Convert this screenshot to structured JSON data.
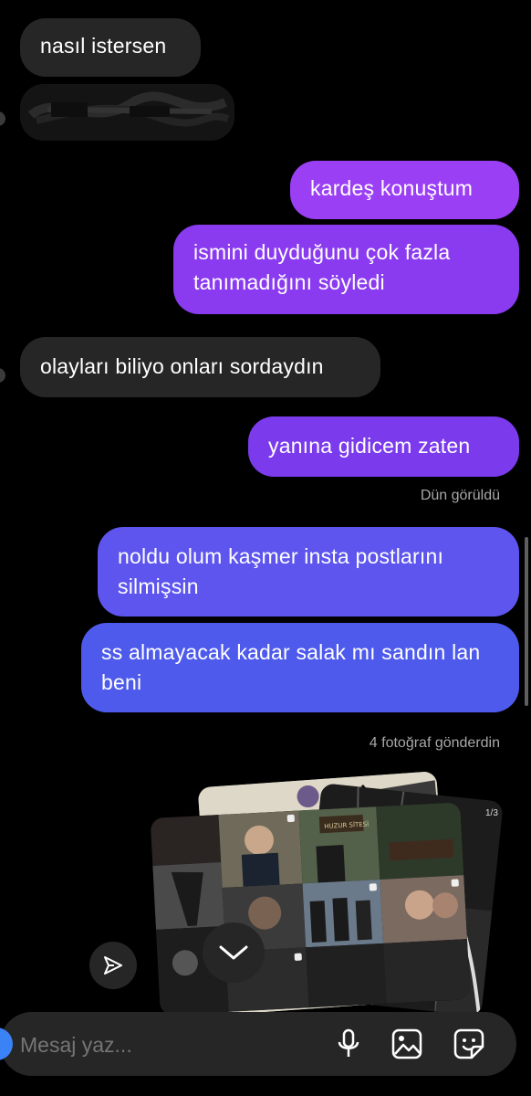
{
  "messages": [
    {
      "side": "in",
      "text": "nasıl istersen"
    },
    {
      "side": "in",
      "text": "(gizlenmiş)"
    },
    {
      "side": "out",
      "text": "kardeş konuştum"
    },
    {
      "side": "out",
      "text": "ismini duyduğunu çok fazla tanımadığını söyledi"
    },
    {
      "side": "in",
      "text": "olayları biliyo onları sordaydın"
    },
    {
      "side": "out",
      "text": "yanına gidicem zaten"
    },
    {
      "side": "out",
      "text": "noldu olum kaşmer insta postlarını silmişsin"
    },
    {
      "side": "out",
      "text": "ss almayacak kadar salak mı sandın lan beni"
    }
  ],
  "seen_status": "Dün görüldü",
  "photos_status": "4 fotoğraf gönderdin",
  "photo_counter": "1/3",
  "photo_sign_text": "HUZUR SİTESİ",
  "composer": {
    "placeholder": "Mesaj yaz..."
  },
  "icons": {
    "send": "paper-plane-icon",
    "scroll_down": "chevron-down-icon",
    "mic": "microphone-icon",
    "gallery": "image-icon",
    "sticker": "sticker-icon"
  },
  "colors": {
    "incoming": "#262626",
    "outgoing_top": "#a244f5",
    "outgoing_mid": "#7c3aed",
    "outgoing_bottom": "#4f5bec",
    "bg": "#000000",
    "meta": "#a8a8a8"
  }
}
